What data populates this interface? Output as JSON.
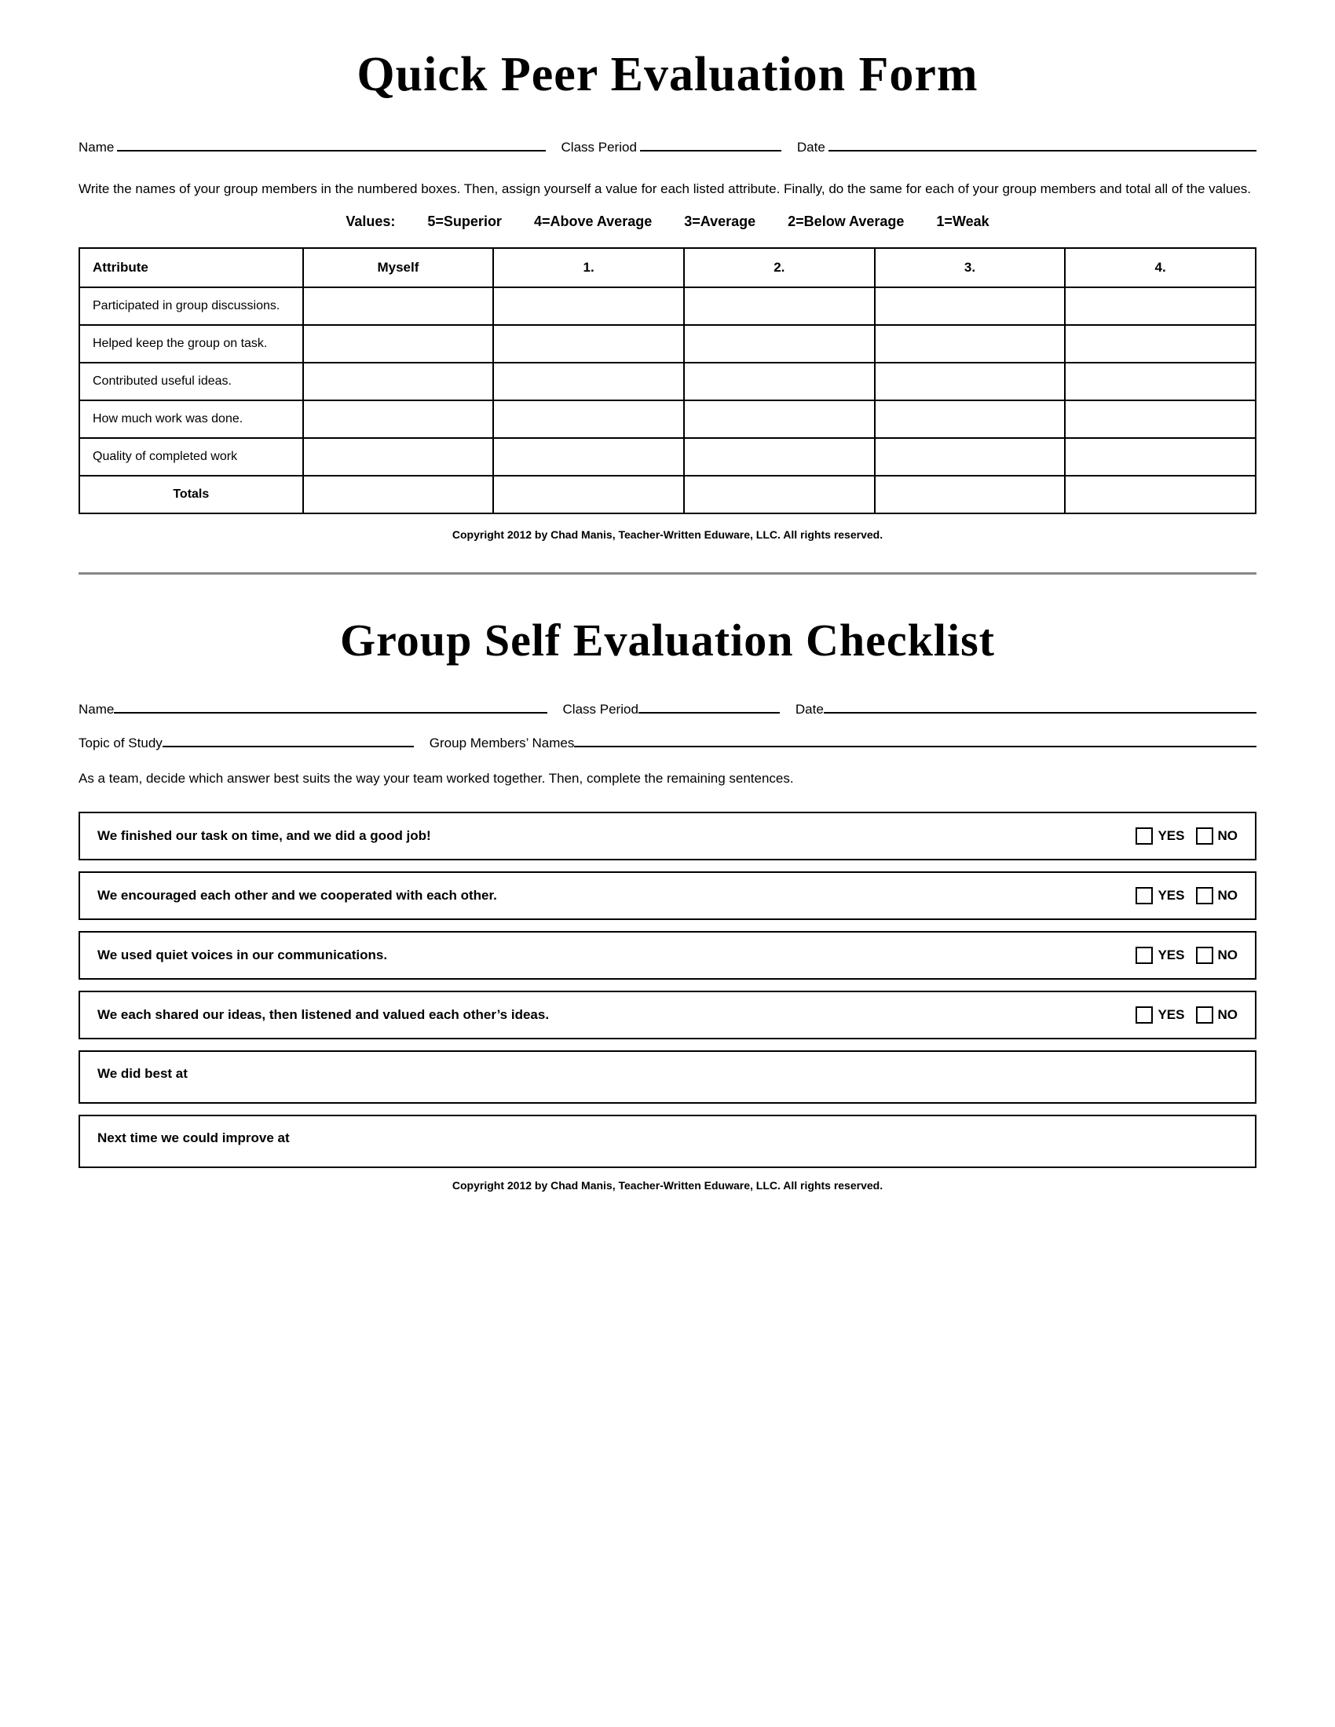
{
  "section1": {
    "title": "Quick Peer Evaluation Form",
    "name_label": "Name",
    "class_period_label": "Class Period",
    "date_label": "Date",
    "instructions": "Write the names of your group members in the numbered boxes.  Then,  assign yourself a value for each listed attribute.  Finally, do the same for each of your group members and total all of the values.",
    "values_label": "Values:",
    "values": [
      "5=Superior",
      "4=Above Average",
      "3=Average",
      "2=Below Average",
      "1=Weak"
    ],
    "table": {
      "headers": [
        "Attribute",
        "Myself",
        "1.",
        "2.",
        "3.",
        "4."
      ],
      "rows": [
        "Participated in group discussions.",
        "Helped keep the group on task.",
        "Contributed useful ideas.",
        "How much work was done.",
        "Quality of completed work"
      ],
      "totals_label": "Totals"
    },
    "copyright": "Copyright 2012 by Chad Manis, Teacher-Written Eduware, LLC.  All rights reserved."
  },
  "section2": {
    "title": "Group Self Evaluation Checklist",
    "name_label": "Name",
    "class_period_label": "Class Period",
    "date_label": "Date",
    "topic_label": "Topic of Study",
    "group_members_label": "Group Members’ Names",
    "instructions": "As a team, decide which answer best suits the way your team worked together.  Then, complete the remaining sentences.",
    "checklist_items": [
      "We finished our task on time, and we did a good job!",
      "We encouraged each other and we cooperated with each other.",
      "We used quiet voices in our communications.",
      "We each shared our ideas, then listened and valued each other’s ideas."
    ],
    "yes_label": "YES",
    "no_label": "NO",
    "open_items": [
      "We did best at",
      "Next time we could improve at"
    ],
    "copyright": "Copyright 2012 by Chad Manis, Teacher-Written Eduware, LLC.  All rights reserved."
  }
}
